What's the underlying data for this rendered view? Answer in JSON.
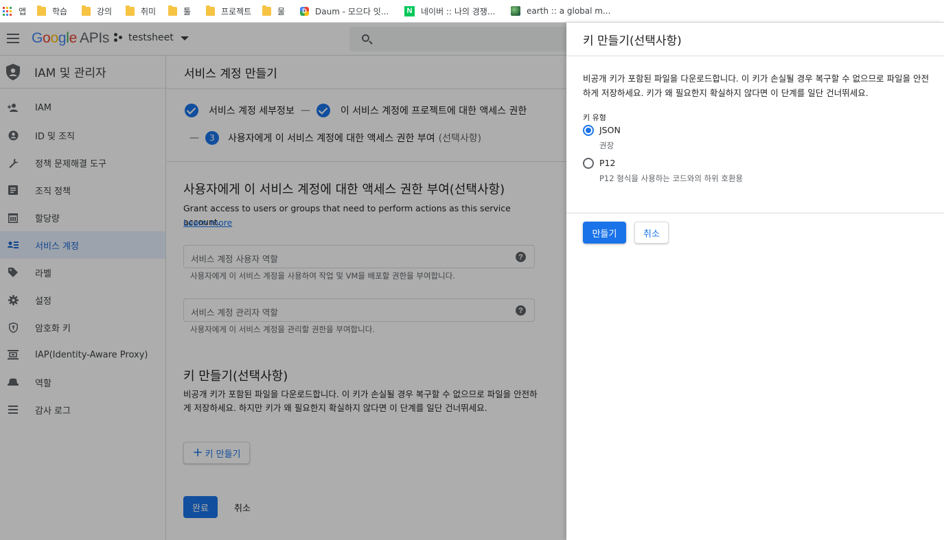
{
  "bookmarks": [
    {
      "label": "앱",
      "icon": "apps-grid-icon"
    },
    {
      "label": "학습",
      "icon": "folder-icon"
    },
    {
      "label": "강의",
      "icon": "folder-icon"
    },
    {
      "label": "취미",
      "icon": "folder-icon"
    },
    {
      "label": "툴",
      "icon": "folder-icon"
    },
    {
      "label": "프로젝트",
      "icon": "folder-icon"
    },
    {
      "label": "물",
      "icon": "folder-icon"
    },
    {
      "label": "Daum - 모으다 잇...",
      "icon": "daum-icon"
    },
    {
      "label": "네이버 :: 나의 경쟁...",
      "icon": "naver-icon"
    },
    {
      "label": "earth :: a global m...",
      "icon": "earth-icon"
    }
  ],
  "header": {
    "logo_google": "Google",
    "logo_apis": "APIs",
    "project": "testsheet"
  },
  "sidebar": {
    "title": "IAM 및 관리자",
    "items": [
      {
        "label": "IAM",
        "icon": "person-add-icon"
      },
      {
        "label": "ID 및 조직",
        "icon": "account-circle-icon"
      },
      {
        "label": "정책 문제해결 도구",
        "icon": "wrench-icon"
      },
      {
        "label": "조직 정책",
        "icon": "list-icon"
      },
      {
        "label": "할당량",
        "icon": "calendar-icon"
      },
      {
        "label": "서비스 계정",
        "icon": "service-account-icon",
        "active": true
      },
      {
        "label": "라벨",
        "icon": "tag-icon"
      },
      {
        "label": "설정",
        "icon": "gear-icon"
      },
      {
        "label": "암호화 키",
        "icon": "shield-key-icon"
      },
      {
        "label": "IAP(Identity-Aware Proxy)",
        "icon": "proxy-icon"
      },
      {
        "label": "역할",
        "icon": "hat-icon"
      },
      {
        "label": "감사 로그",
        "icon": "lines-icon"
      }
    ]
  },
  "main": {
    "title": "서비스 계정 만들기",
    "step1": "서비스 계정 세부정보",
    "step2": "이 서비스 계정에 프로젝트에 대한 액세스 권한",
    "step_dash": "—",
    "step3_num": "3",
    "step3": "사용자에게 이 서비스 계정에 대한 액세스 권한 부여",
    "step3_optional": "(선택사항)",
    "section_title": "사용자에게 이 서비스 계정에 대한 액세스 권한 부여(선택사항)",
    "section_desc": "Grant access to users or groups that need to perform actions as this service account.",
    "learn_more": "Learn more",
    "field1_placeholder": "서비스 계정 사용자 역할",
    "field1_hint": "사용자에게 이 서비스 계정을 사용하여 작업 및 VM을 배포할 권한을 부여합니다.",
    "field2_placeholder": "서비스 계정 관리자 역할",
    "field2_hint": "사용자에게 이 서비스 계정을 관리할 권한을 부여합니다.",
    "help_glyph": "?",
    "key_title": "키 만들기(선택사항)",
    "key_desc": "비공개 키가 포함된 파일을 다운로드합니다. 이 키가 손실될 경우 복구할 수 없으므로 파일을 안전하게 저장하세요. 하지만 키가 왜 필요한지 확실하지 않다면 이 단계를 일단 건너뛰세요.",
    "key_button": "키 만들기",
    "done_button": "완료",
    "cancel_button": "취소"
  },
  "panel": {
    "title": "키 만들기(선택사항)",
    "desc": "비공개 키가 포함된 파일을 다운로드합니다. 이 키가 손실될 경우 복구할 수 없으므로 파일을 안전하게 저장하세요. 키가 왜 필요한지 확실하지 않다면 이 단계를 일단 건너뛰세요.",
    "key_type_label": "키 유형",
    "option_json": "JSON",
    "option_json_sub": "권장",
    "option_p12": "P12",
    "option_p12_sub": "P12 형식을 사용하는 코드와의 하위 호환용",
    "selected": "JSON",
    "create_button": "만들기",
    "cancel_button": "취소"
  },
  "colors": {
    "accent": "#1a73e8",
    "active_nav_bg": "#e8f0fe"
  }
}
